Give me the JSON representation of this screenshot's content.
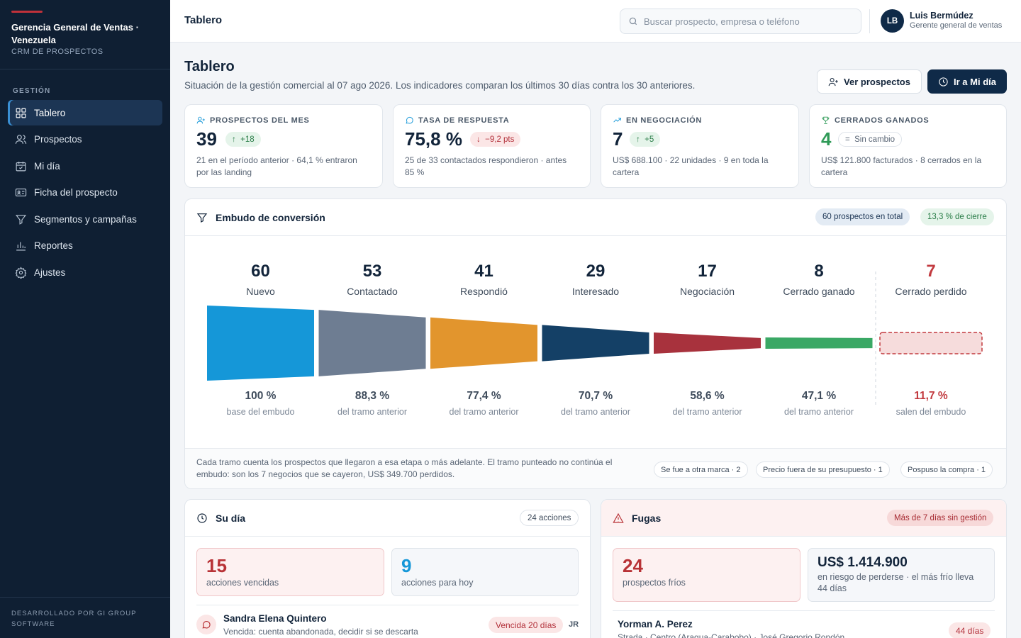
{
  "sidebar": {
    "org": "Gerencia General de Ventas · Venezuela",
    "product": "CRM DE PROSPECTOS",
    "section": "GESTIÓN",
    "items": [
      {
        "label": "Tablero",
        "icon": "grid-icon"
      },
      {
        "label": "Prospectos",
        "icon": "users-icon"
      },
      {
        "label": "Mi día",
        "icon": "calendar-icon"
      },
      {
        "label": "Ficha del prospecto",
        "icon": "id-card-icon"
      },
      {
        "label": "Segmentos y campañas",
        "icon": "filter-icon"
      },
      {
        "label": "Reportes",
        "icon": "bar-chart-icon"
      },
      {
        "label": "Ajustes",
        "icon": "gear-icon"
      }
    ],
    "active": "Tablero",
    "footer": "DESARROLLADO POR GI GROUP SOFTWARE"
  },
  "topbar": {
    "title": "Tablero",
    "search_placeholder": "Buscar prospecto, empresa o teléfono",
    "user_initials": "LB",
    "user_name": "Luis Bermúdez",
    "user_role": "Gerente general de ventas"
  },
  "page": {
    "title": "Tablero",
    "subtitle": "Situación de la gestión comercial al 07 ago 2026. Los indicadores comparan los últimos 30 días contra los 30 anteriores.",
    "btn_prospects": "Ver prospectos",
    "btn_myday": "Ir a Mi día"
  },
  "kpis": [
    {
      "label": "PROSPECTOS DEL MES",
      "value": "39",
      "delta": "+18",
      "trend": "up",
      "note": "21 en el período anterior · 64,1 % entraron por las landing",
      "color": "#12243a"
    },
    {
      "label": "TASA DE RESPUESTA",
      "value": "75,8 %",
      "delta": "−9,2 pts",
      "trend": "down",
      "note": "25 de 33 contactados respondieron · antes 85 %",
      "color": "#12243a"
    },
    {
      "label": "EN NEGOCIACIÓN",
      "value": "7",
      "delta": "+5",
      "trend": "up",
      "note": "US$ 688.100 · 22 unidades · 9 en toda la cartera",
      "color": "#12243a"
    },
    {
      "label": "CERRADOS GANADOS",
      "value": "4",
      "delta": "Sin cambio",
      "trend": "flat",
      "note": "US$ 121.800 facturados · 8 cerrados en la cartera",
      "color": "#2f9a57"
    }
  ],
  "funnel": {
    "title": "Embudo de conversión",
    "total_badge": "60 prospectos en total",
    "close_badge": "13,3 % de cierre",
    "stages": [
      {
        "count": "60",
        "name": "Nuevo",
        "value": 60,
        "pct": "100 %",
        "desc": "base del embudo",
        "color": "#1597d8"
      },
      {
        "count": "53",
        "name": "Contactado",
        "value": 53,
        "pct": "88,3 %",
        "desc": "del tramo anterior",
        "color": "#6e7d92"
      },
      {
        "count": "41",
        "name": "Respondió",
        "value": 41,
        "pct": "77,4 %",
        "desc": "del tramo anterior",
        "color": "#e2952d"
      },
      {
        "count": "29",
        "name": "Interesado",
        "value": 29,
        "pct": "70,7 %",
        "desc": "del tramo anterior",
        "color": "#144066"
      },
      {
        "count": "17",
        "name": "Negociación",
        "value": 17,
        "pct": "58,6 %",
        "desc": "del tramo anterior",
        "color": "#a8323d"
      },
      {
        "count": "8",
        "name": "Cerrado ganado",
        "value": 8,
        "pct": "47,1 %",
        "desc": "del tramo anterior",
        "color": "#3aa865"
      }
    ],
    "lost": {
      "count": "7",
      "name": "Cerrado perdido",
      "value": 7,
      "pct": "11,7 %",
      "desc": "salen del embudo"
    },
    "footnote": "Cada tramo cuenta los prospectos que llegaron a esa etapa o más adelante. El tramo punteado no continúa el embudo: son los 7 negocios que se cayeron, US$ 349.700 perdidos.",
    "reasons": [
      "Se fue a otra marca · 2",
      "Precio fuera de su presupuesto · 1",
      "Pospuso la compra · 1"
    ]
  },
  "chart_data": {
    "type": "bar",
    "categories": [
      "Nuevo",
      "Contactado",
      "Respondió",
      "Interesado",
      "Negociación",
      "Cerrado ganado",
      "Cerrado perdido"
    ],
    "values": [
      60,
      53,
      41,
      29,
      17,
      8,
      7
    ],
    "title": "Embudo de conversión"
  },
  "myday": {
    "title": "Su día",
    "badge": "24 acciones",
    "overdue_n": "15",
    "overdue_label": "acciones vencidas",
    "today_n": "9",
    "today_label": "acciones para hoy",
    "rows": [
      {
        "name": "Sandra Elena Quintero",
        "sub": "Vencida: cuenta abandonada, decidir si se descarta",
        "status": "Vencida 20 días",
        "owner": "JR"
      }
    ]
  },
  "leaks": {
    "title": "Fugas",
    "badge": "Más de 7 días sin gestión",
    "cold_n": "24",
    "cold_label": "prospectos fríos",
    "risk_n": "US$ 1.414.900",
    "risk_label": "en riesgo de perderse · el más frío lleva 44 días",
    "rows": [
      {
        "name": "Yorman A. Perez",
        "sub": "Strada · Centro (Aragua-Carabobo) · José Gregorio Rondón",
        "days": "44 días"
      }
    ]
  }
}
